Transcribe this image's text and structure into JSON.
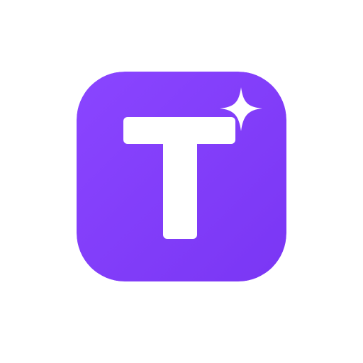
{
  "app_icon": {
    "letter": "T",
    "icon_name": "text-sparkle-app-icon",
    "decoration_icon": "sparkle-icon",
    "colors": {
      "background_top": "#8a45ff",
      "background_bottom": "#7a36f4",
      "glyph": "#ffffff",
      "page_background": "#ffffff"
    }
  }
}
